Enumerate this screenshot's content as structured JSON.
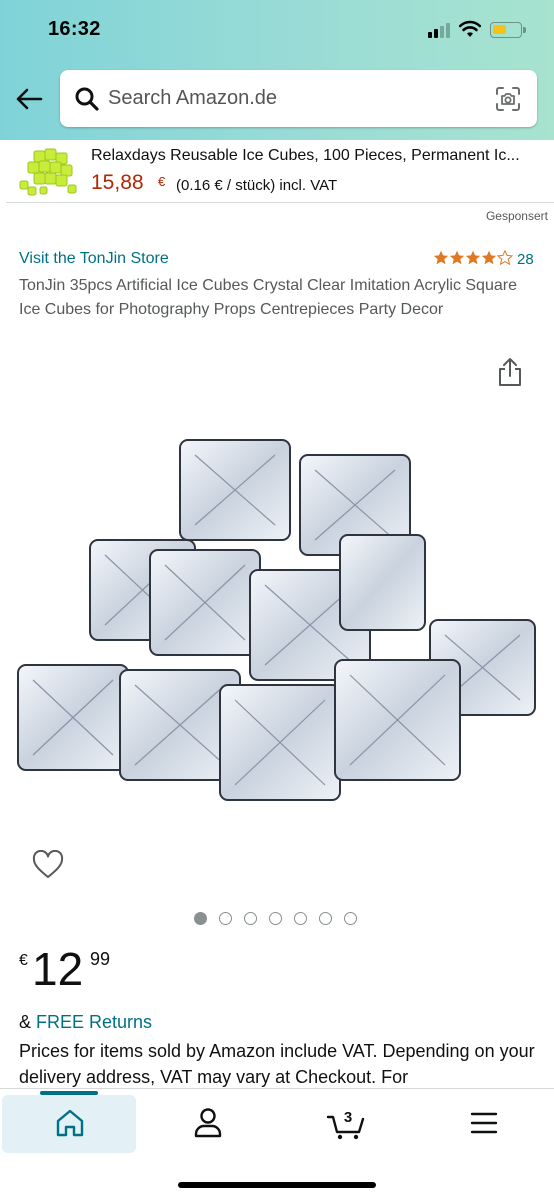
{
  "status_bar": {
    "time": "16:32"
  },
  "search": {
    "placeholder": "Search Amazon.de"
  },
  "sponsored_banner": {
    "title": "Relaxdays Reusable Ice Cubes, 100 Pieces, Permanent Ic...",
    "price": "15,88",
    "currency": "€",
    "unit_price": "(0.16 € / stück) incl. VAT"
  },
  "sponsored_label": "Gesponsert",
  "product": {
    "store_link": "Visit the TonJin Store",
    "rating_stars": 4.5,
    "rating_count": "28",
    "title": "TonJin 35pcs Artificial Ice Cubes Crystal Clear Imitation Acrylic Square Ice Cubes for Photography Props Centrepieces Party Decor",
    "image_count": 7,
    "active_image": 1,
    "price_symbol": "€",
    "price_whole": "12",
    "price_fraction": "99",
    "returns_prefix": "& ",
    "returns_link": "FREE Returns",
    "vat_text": "Prices for items sold by Amazon include VAT. Depending on your delivery address, VAT may vary at Checkout. For"
  },
  "bottom_nav": {
    "items": [
      {
        "name": "home",
        "icon": "home-icon",
        "active": true
      },
      {
        "name": "account",
        "icon": "person-icon",
        "active": false
      },
      {
        "name": "cart",
        "icon": "cart-icon",
        "active": false,
        "badge": "3"
      },
      {
        "name": "menu",
        "icon": "hamburger-menu-icon",
        "active": false
      }
    ]
  },
  "colors": {
    "link": "#007185",
    "price_red": "#b12704",
    "star": "#de7921",
    "header_gradient_start": "#7fd3d8",
    "header_gradient_end": "#a7e3cf"
  }
}
